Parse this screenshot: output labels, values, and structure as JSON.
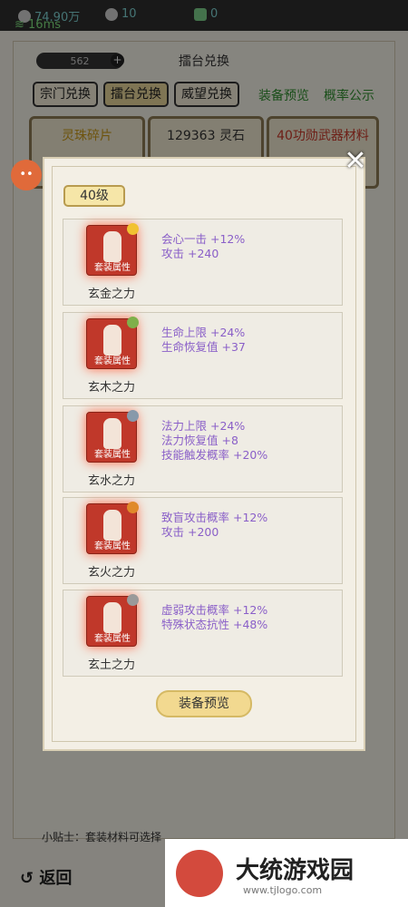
{
  "topbar": {
    "coins": "74.90万",
    "gems": "10",
    "jade": "0",
    "ping": "16ms"
  },
  "header": {
    "title": "擂台兑换",
    "points": "562",
    "plus": "+"
  },
  "tabs": [
    {
      "label": "宗门兑换",
      "active": false
    },
    {
      "label": "擂台兑换",
      "active": true
    },
    {
      "label": "威望兑换",
      "active": false
    }
  ],
  "links": {
    "preview": "装备预览",
    "rates": "概率公示"
  },
  "cards": [
    {
      "label": "灵珠碎片"
    },
    {
      "label": "129363 灵石"
    },
    {
      "label": "40功勋武器材料"
    }
  ],
  "modal": {
    "level": "40级",
    "close": "✕",
    "items": [
      {
        "name": "玄金之力",
        "tag": "套装属性",
        "stone": "#f1c232",
        "stats": [
          "会心一击 +12%",
          "攻击 +240"
        ]
      },
      {
        "name": "玄木之力",
        "tag": "套装属性",
        "stone": "#7fb04a",
        "stats": [
          "生命上限 +24%",
          "生命恢复值 +37"
        ]
      },
      {
        "name": "玄水之力",
        "tag": "套装属性",
        "stone": "#8899aa",
        "stats": [
          "法力上限 +24%",
          "法力恢复值 +8",
          "技能触发概率 +20%"
        ]
      },
      {
        "name": "玄火之力",
        "tag": "套装属性",
        "stone": "#e08a2a",
        "stats": [
          "致盲攻击概率 +12%",
          "攻击 +200"
        ]
      },
      {
        "name": "玄土之力",
        "tag": "套装属性",
        "stone": "#9a9a9a",
        "stats": [
          "虚弱攻击概率 +12%",
          "特殊状态抗性 +48%"
        ]
      }
    ],
    "button": "装备预览"
  },
  "footer": {
    "tip": "小贴士：套装材料可选择",
    "back": "返回"
  },
  "watermark": {
    "text": "大统游戏园",
    "url": "www.tjlogo.com"
  }
}
